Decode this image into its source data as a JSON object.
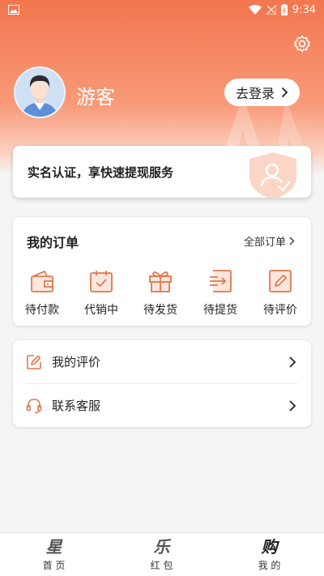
{
  "status_bar": {
    "time": "9:34"
  },
  "profile": {
    "username": "游客",
    "login_label": "去登录"
  },
  "verify_banner": {
    "text": "实名认证，享快速提现服务"
  },
  "orders": {
    "title": "我的订单",
    "all_label": "全部订单",
    "items": [
      {
        "label": "待付款",
        "icon": "wallet-icon"
      },
      {
        "label": "代销中",
        "icon": "calendar-check-icon"
      },
      {
        "label": "待发货",
        "icon": "gift-icon"
      },
      {
        "label": "待提货",
        "icon": "pickup-icon"
      },
      {
        "label": "待评价",
        "icon": "edit-icon"
      }
    ]
  },
  "menu": {
    "items": [
      {
        "label": "我的评价",
        "icon": "pen-square-icon"
      },
      {
        "label": "联系客服",
        "icon": "headset-icon"
      }
    ]
  },
  "tabbar": {
    "tabs": [
      {
        "glyph": "星",
        "label": "首 页"
      },
      {
        "glyph": "乐",
        "label": "红 包"
      },
      {
        "glyph": "购",
        "label": "我 的",
        "active": true
      }
    ]
  },
  "colors": {
    "accent": "#f3764e",
    "icon_orange": "#e0784f"
  }
}
